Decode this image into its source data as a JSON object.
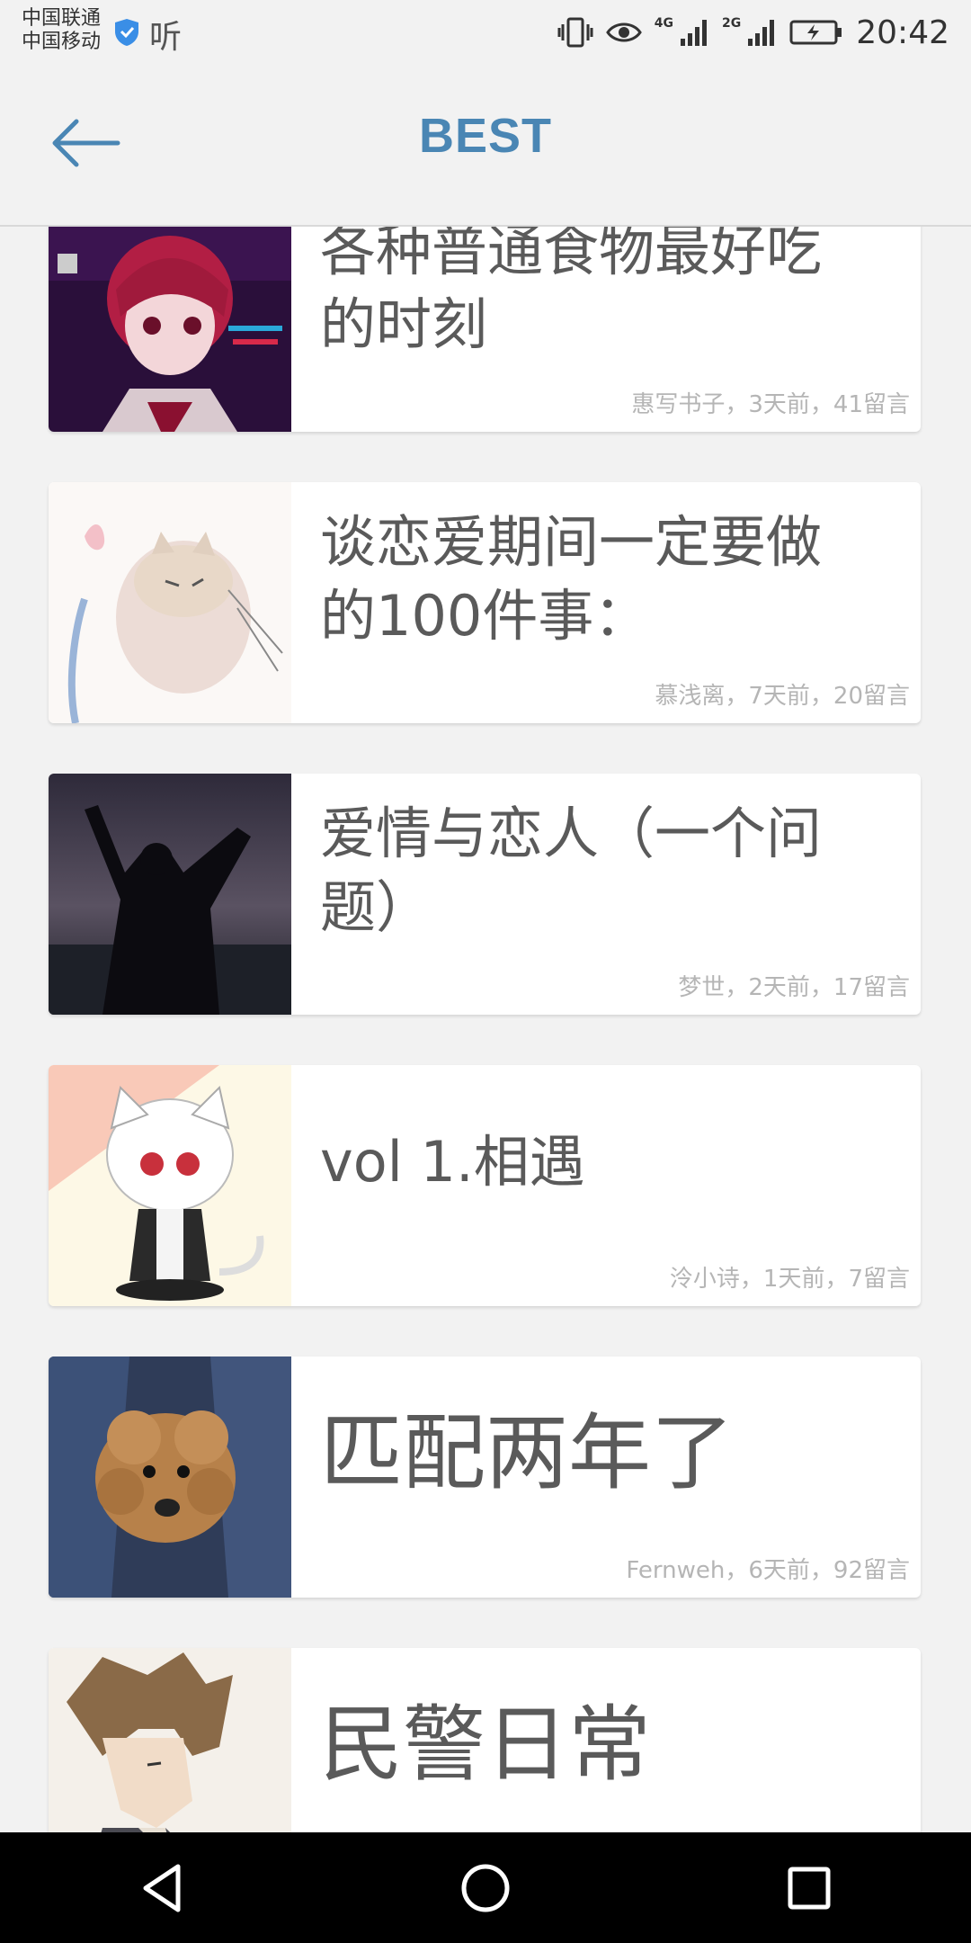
{
  "status_bar": {
    "carrier_1": "中国联通",
    "carrier_2": "中国移动",
    "app_indicator": "听",
    "network_1": "4G",
    "network_2": "2G",
    "time": "20:42"
  },
  "header": {
    "title": "BEST",
    "back_icon": "arrow-left-icon"
  },
  "posts": [
    {
      "title": "各种普通食物最好吃的时刻",
      "meta": "惠写书子，3天前，41留言"
    },
    {
      "title": "谈恋爱期间一定要做的100件事：",
      "meta": "慕浅离，7天前，20留言"
    },
    {
      "title": "爱情与恋人（一个问题）",
      "meta": "梦世，2天前，17留言"
    },
    {
      "title": "vol 1.相遇",
      "meta": "泠小诗，1天前，7留言"
    },
    {
      "title": "匹配两年了",
      "meta": "Fernweh，6天前，92留言"
    },
    {
      "title": "民警日常",
      "meta": ""
    }
  ],
  "nav": {
    "back": "triangle-back-icon",
    "home": "circle-home-icon",
    "recents": "square-recents-icon"
  },
  "colors": {
    "accent": "#4a86b4",
    "background": "#f2f2f2",
    "card": "#ffffff",
    "meta_text": "#b5b5b5"
  }
}
